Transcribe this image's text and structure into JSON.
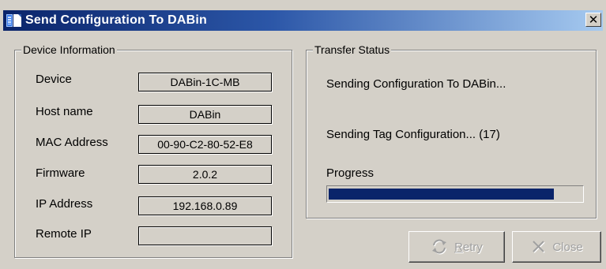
{
  "window": {
    "title": "Send Configuration To DABin",
    "close_glyph": "✕"
  },
  "device_info": {
    "group_title": "Device Information",
    "fields": [
      {
        "label": "Device",
        "value": "DABin-1C-MB"
      },
      {
        "label": "Host name",
        "value": "DABin"
      },
      {
        "label": "MAC Address",
        "value": "00-90-C2-80-52-E8"
      },
      {
        "label": "Firmware",
        "value": "2.0.2"
      },
      {
        "label": "IP Address",
        "value": "192.168.0.89"
      },
      {
        "label": "Remote IP",
        "value": ""
      }
    ]
  },
  "transfer_status": {
    "group_title": "Transfer Status",
    "status_line_1": "Sending Configuration To DABin...",
    "status_line_2": "Sending Tag Configuration... (17)",
    "progress_label": "Progress",
    "progress_fraction": 0.89,
    "progress_color": "#0a246a"
  },
  "buttons": {
    "retry": {
      "accel": "R",
      "rest": "etry",
      "icon": "refresh-icon",
      "enabled": false
    },
    "close": {
      "label": "Close",
      "icon": "x-icon",
      "enabled": false
    }
  },
  "colors": {
    "title_start": "#0a246a",
    "title_end": "#a6caf0",
    "face": "#d4d0c8",
    "disabled_text": "#a0a0a0"
  }
}
